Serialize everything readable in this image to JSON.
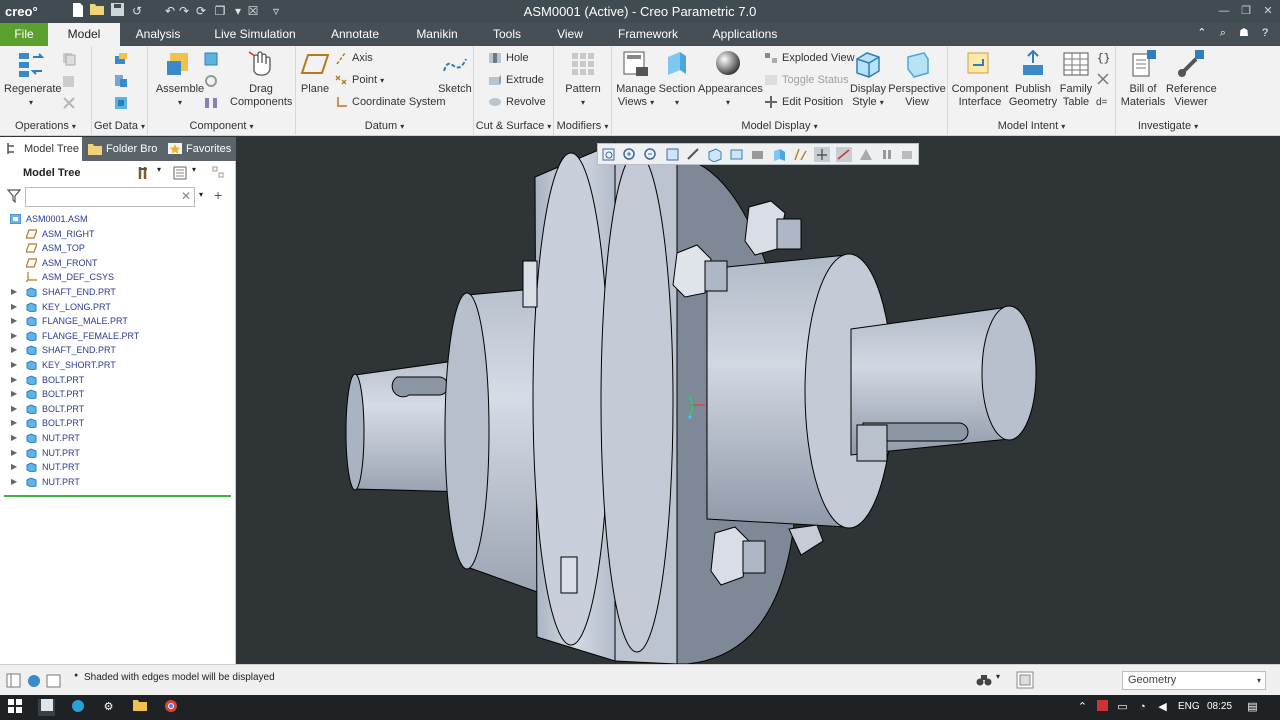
{
  "app": {
    "logo": "creo°",
    "window_title": "ASM0001 (Active) - Creo Parametric 7.0"
  },
  "ribbon_tabs": [
    "File",
    "Model",
    "Analysis",
    "Live Simulation",
    "Annotate",
    "Manikin",
    "Tools",
    "View",
    "Framework",
    "Applications"
  ],
  "ribbon": {
    "operations": {
      "label": "Operations",
      "regenerate": "Regenerate"
    },
    "get_data": {
      "label": "Get Data"
    },
    "component": {
      "label": "Component",
      "assemble": "Assemble",
      "drag_components_1": "Drag",
      "drag_components_2": "Components"
    },
    "datum": {
      "label": "Datum",
      "plane": "Plane",
      "axis": "Axis",
      "point": "Point",
      "coordinate_system": "Coordinate System",
      "sketch": "Sketch"
    },
    "cut_surface": {
      "label": "Cut & Surface",
      "hole": "Hole",
      "extrude": "Extrude",
      "revolve": "Revolve"
    },
    "modifiers": {
      "label": "Modifiers",
      "pattern": "Pattern"
    },
    "model_display": {
      "label": "Model Display",
      "manage_views_1": "Manage",
      "manage_views_2": "Views",
      "section": "Section",
      "appearances": "Appearances",
      "exploded_view": "Exploded View",
      "toggle_status": "Toggle Status",
      "edit_position": "Edit Position",
      "display_style_1": "Display",
      "display_style_2": "Style",
      "perspective_view_1": "Perspective",
      "perspective_view_2": "View"
    },
    "model_intent": {
      "label": "Model Intent",
      "component_interface_1": "Component",
      "component_interface_2": "Interface",
      "publish_geometry_1": "Publish",
      "publish_geometry_2": "Geometry",
      "family_table_1": "Family",
      "family_table_2": "Table"
    },
    "investigate": {
      "label": "Investigate",
      "bill_of_materials_1": "Bill of",
      "bill_of_materials_2": "Materials",
      "reference_viewer_1": "Reference",
      "reference_viewer_2": "Viewer"
    }
  },
  "left_panel": {
    "tabs": [
      "Model Tree",
      "Folder Bro",
      "Favorites"
    ],
    "tree_title": "Model Tree",
    "search_placeholder": "",
    "items": [
      {
        "label": "ASM0001.ASM",
        "kind": "asm",
        "expandable": false
      },
      {
        "label": "ASM_RIGHT",
        "kind": "plane",
        "expandable": false
      },
      {
        "label": "ASM_TOP",
        "kind": "plane",
        "expandable": false
      },
      {
        "label": "ASM_FRONT",
        "kind": "plane",
        "expandable": false
      },
      {
        "label": "ASM_DEF_CSYS",
        "kind": "csys",
        "expandable": false
      },
      {
        "label": "SHAFT_END.PRT",
        "kind": "part",
        "expandable": true
      },
      {
        "label": "KEY_LONG.PRT",
        "kind": "part",
        "expandable": true
      },
      {
        "label": "FLANGE_MALE.PRT",
        "kind": "part",
        "expandable": true
      },
      {
        "label": "FLANGE_FEMALE.PRT",
        "kind": "part",
        "expandable": true
      },
      {
        "label": "SHAFT_END.PRT",
        "kind": "part",
        "expandable": true
      },
      {
        "label": "KEY_SHORT.PRT",
        "kind": "part",
        "expandable": true
      },
      {
        "label": "BOLT.PRT",
        "kind": "part",
        "expandable": true
      },
      {
        "label": "BOLT.PRT",
        "kind": "part",
        "expandable": true
      },
      {
        "label": "BOLT.PRT",
        "kind": "part",
        "expandable": true
      },
      {
        "label": "BOLT.PRT",
        "kind": "part",
        "expandable": true
      },
      {
        "label": "NUT.PRT",
        "kind": "part",
        "expandable": true
      },
      {
        "label": "NUT.PRT",
        "kind": "part",
        "expandable": true
      },
      {
        "label": "NUT.PRT",
        "kind": "part",
        "expandable": true
      },
      {
        "label": "NUT.PRT",
        "kind": "part",
        "expandable": true
      }
    ]
  },
  "status": {
    "message": "Shaded with edges model will be displayed",
    "filter_value": "Geometry"
  },
  "taskbar": {
    "language": "ENG",
    "time": "08:25"
  },
  "colors": {
    "file_tab": "#5ca130",
    "title_bar": "#414b52",
    "viewport_bg": "#2f3537",
    "model_grey": "#c4cbd6",
    "tree_link": "#2a3b8f"
  }
}
